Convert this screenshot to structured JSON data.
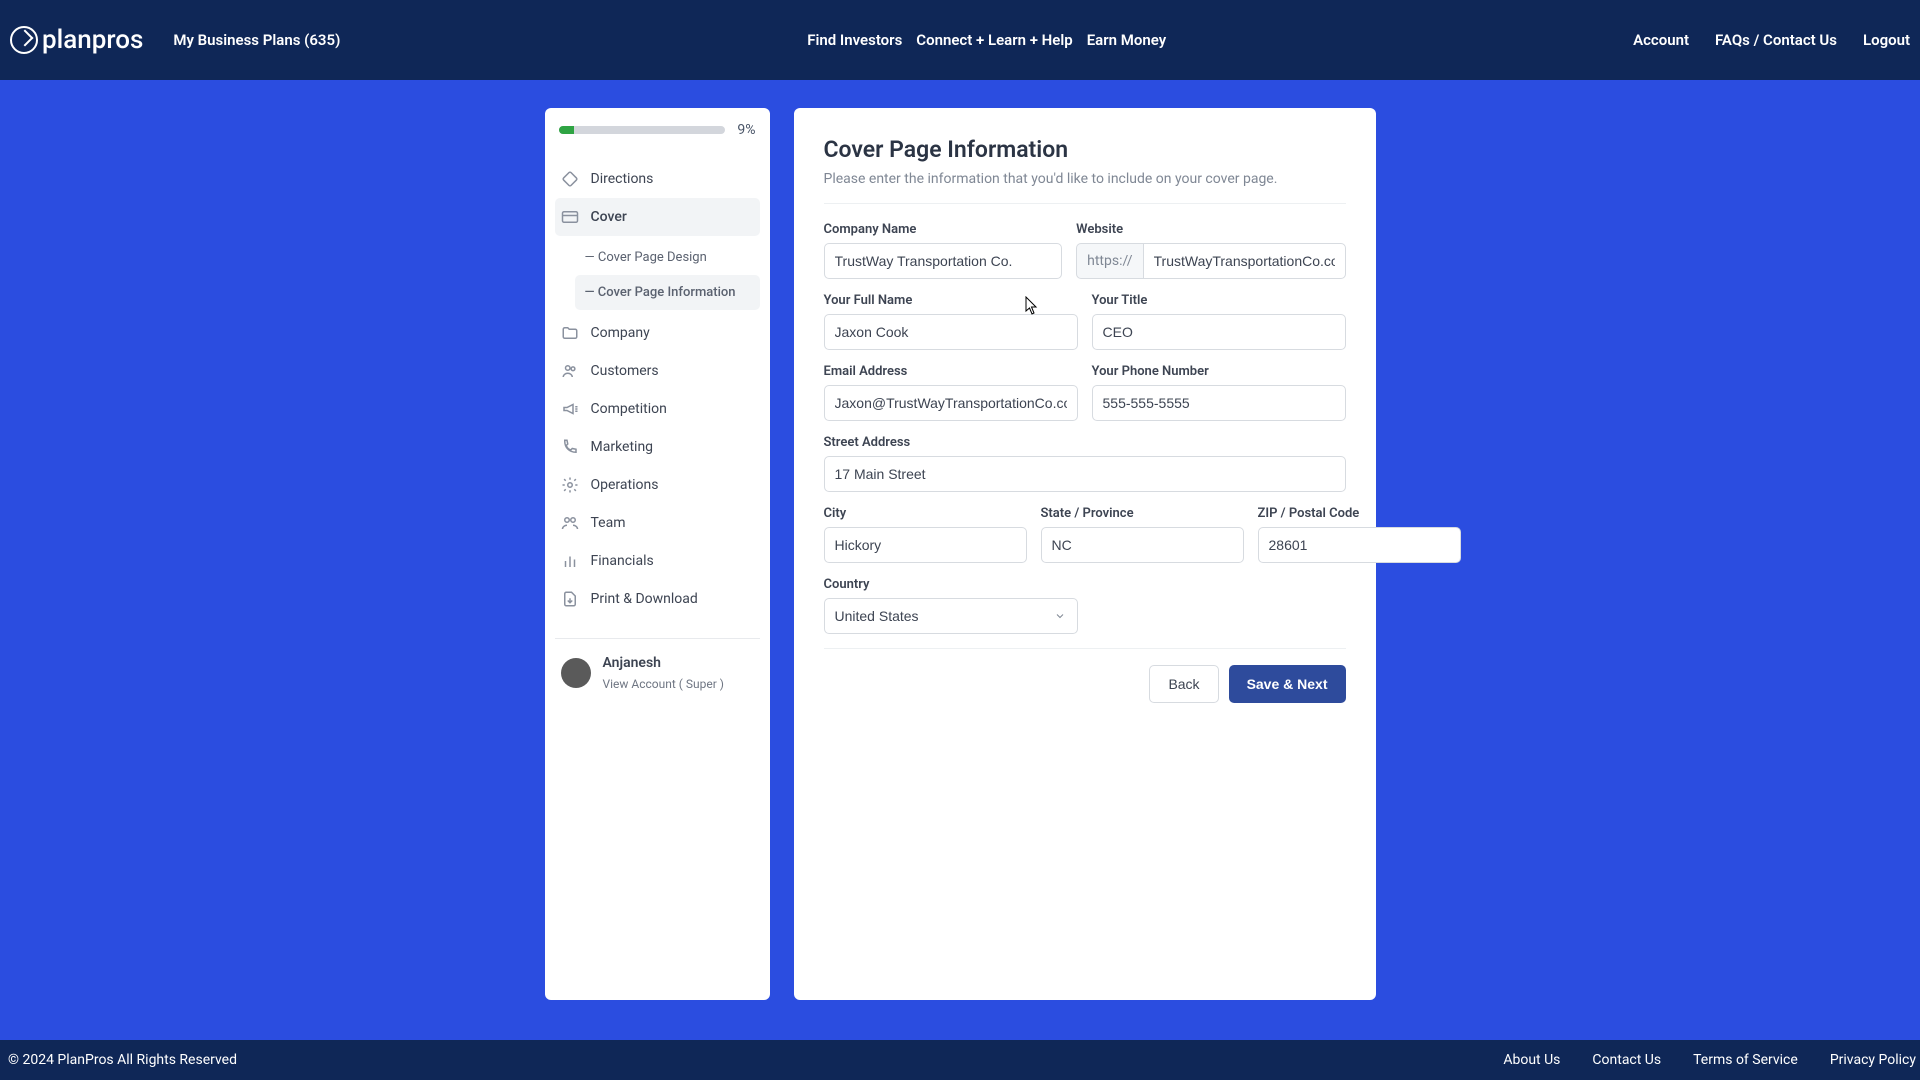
{
  "header": {
    "brand": "planpros",
    "myPlans": "My Business Plans (635)",
    "center": {
      "findInvestors": "Find Investors",
      "connect": "Connect + Learn + Help",
      "earnMoney": "Earn Money"
    },
    "right": {
      "account": "Account",
      "faqs": "FAQs / Contact Us",
      "logout": "Logout"
    }
  },
  "sidebar": {
    "progress": "9%",
    "items": {
      "directions": "Directions",
      "cover": "Cover",
      "company": "Company",
      "customers": "Customers",
      "competition": "Competition",
      "marketing": "Marketing",
      "operations": "Operations",
      "team": "Team",
      "financials": "Financials",
      "print": "Print & Download"
    },
    "coverSub": {
      "design": "—  Cover Page Design",
      "info": "—  Cover Page Information"
    },
    "user": {
      "name": "Anjanesh",
      "link": "View Account ( Super )"
    }
  },
  "form": {
    "title": "Cover Page Information",
    "subtitle": "Please enter the information that you'd like to include on your cover page.",
    "labels": {
      "companyName": "Company Name",
      "website": "Website",
      "fullName": "Your Full Name",
      "yourTitle": "Your Title",
      "email": "Email Address",
      "phone": "Your Phone Number",
      "street": "Street Address",
      "city": "City",
      "state": "State / Province",
      "zip": "ZIP / Postal Code",
      "country": "Country"
    },
    "values": {
      "companyName": "TrustWay Transportation Co.",
      "websitePrefix": "https://",
      "website": "TrustWayTransportationCo.com",
      "fullName": "Jaxon Cook",
      "yourTitle": "CEO",
      "email": "Jaxon@TrustWayTransportationCo.com",
      "phone": "555-555-5555",
      "street": "17 Main Street",
      "city": "Hickory",
      "state": "NC",
      "zip": "28601",
      "country": "United States"
    },
    "buttons": {
      "back": "Back",
      "save": "Save & Next"
    }
  },
  "footer": {
    "copyright": "© 2024 PlanPros All Rights Reserved",
    "links": {
      "about": "About Us",
      "contact": "Contact Us",
      "terms": "Terms of Service",
      "privacy": "Privacy Policy"
    }
  }
}
